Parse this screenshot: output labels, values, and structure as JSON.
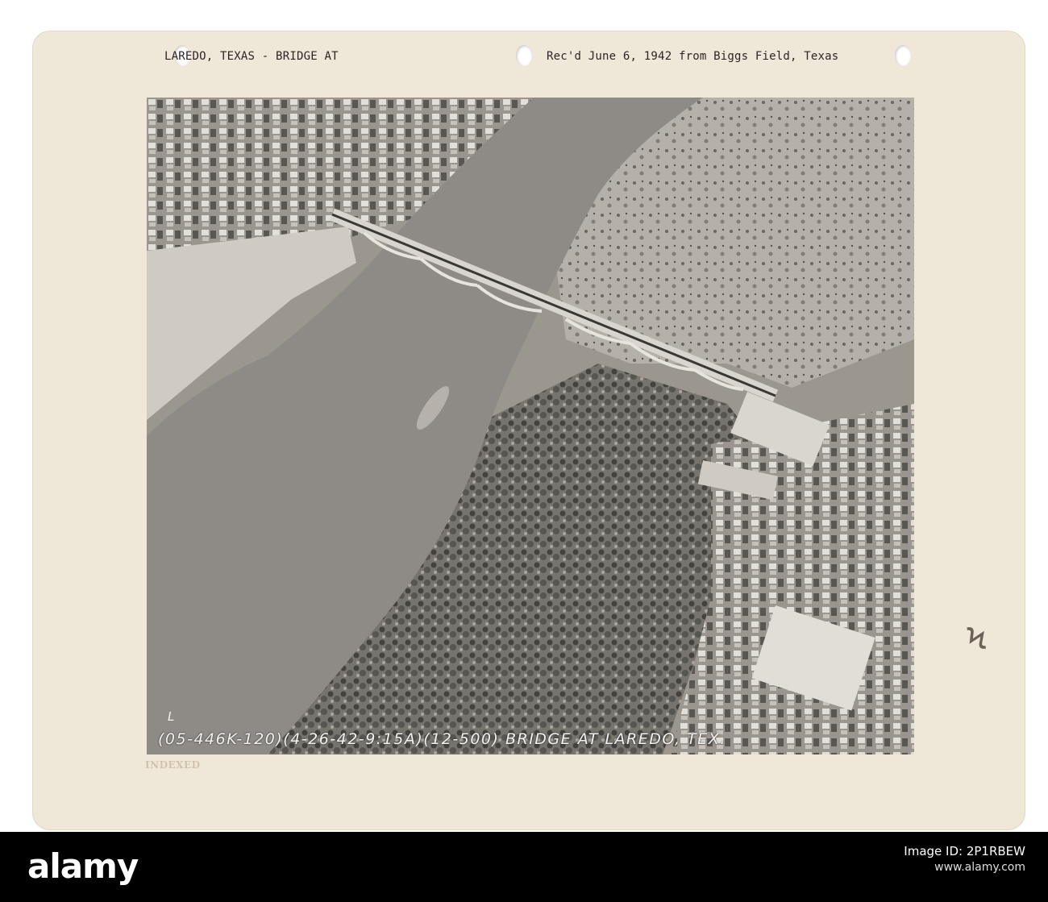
{
  "mount": {
    "left_caption": "LAREDO, TEXAS - BRIDGE AT",
    "right_caption": "Rec'd June 6, 1942 from Biggs Field, Texas",
    "stamp": "INDEXED",
    "pencil_mark": "Ϟ"
  },
  "photo": {
    "negative_letter": "L",
    "inscription": "(05-446K-120)(4-26-42-9:15A)(12-500) BRIDGE AT LAREDO, TEX."
  },
  "watermark": {
    "logo": "alamy",
    "image_id_label": "Image ID: 2P1RBEW",
    "url": "www.alamy.com"
  }
}
